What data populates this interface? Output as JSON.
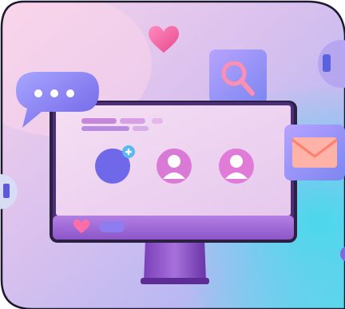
{
  "scene": {
    "kind": "3d-illustration",
    "subject": "desktop-monitor-social-media-profile-ui",
    "colors": {
      "bg_pink": "#efc0e2",
      "bg_lavender": "#c9b3ea",
      "bg_cyan": "#6fd4ea",
      "frame_dark": "#2b2340",
      "monitor_purple": "#8a55c8",
      "screen_light": "#f3dcf1",
      "accent_pink": "#ff6fa8",
      "accent_blue": "#5d7cf0",
      "avatar_pink": "#d67ad6"
    }
  },
  "icons": [
    {
      "name": "heart-icon",
      "position": "top-center"
    },
    {
      "name": "search-icon",
      "position": "top-right"
    },
    {
      "name": "chat-bubble-icon",
      "position": "left"
    },
    {
      "name": "envelope-icon",
      "position": "right"
    },
    {
      "name": "add-user-icon",
      "position": "screen"
    }
  ],
  "screen": {
    "avatars": [
      {
        "name": "avatar-placeholder-add",
        "style": "empty"
      },
      {
        "name": "avatar-user-1",
        "style": "person"
      },
      {
        "name": "avatar-user-2",
        "style": "person"
      }
    ],
    "header_bars": 5,
    "footer_icons": [
      "heart",
      "comment"
    ]
  }
}
